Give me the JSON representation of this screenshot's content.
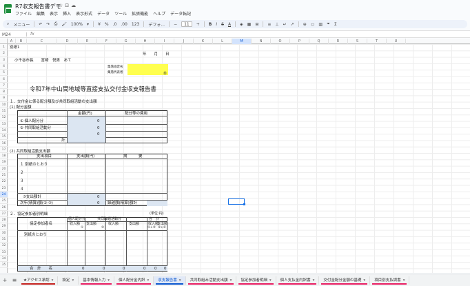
{
  "app": {
    "doc_title": "R7収支報告書デモ"
  },
  "menu": [
    "ファイル",
    "編集",
    "表示",
    "挿入",
    "表示形式",
    "データ",
    "ツール",
    "拡張機能",
    "ヘルプ",
    "データ転記"
  ],
  "toolbar": {
    "search": "メニュー",
    "zoom": "100%",
    "currency": "¥",
    "percent": "%",
    "dec_dec": ".0",
    "dec_inc": ".00",
    "format_123": "123",
    "font": "デフォ...",
    "font_size": "11",
    "bold": "B",
    "italic": "I",
    "strike": "S",
    "color_a": "A"
  },
  "formula": {
    "cell_ref": "M24",
    "fx": "fx"
  },
  "columns": [
    "A",
    "B",
    "C",
    "D",
    "E",
    "F",
    "G",
    "H",
    "I",
    "J",
    "K",
    "L",
    "M",
    "N",
    "O",
    "P",
    "Q",
    "R",
    "S",
    "T",
    "U"
  ],
  "rows": [
    "1",
    "2",
    "3",
    "4",
    "5",
    "6",
    "7",
    "8",
    "9",
    "10",
    "11",
    "12",
    "13",
    "14",
    "15",
    "16",
    "17",
    "18",
    "19",
    "20",
    "21",
    "22",
    "23",
    "24",
    "25",
    "26",
    "27",
    "28",
    "29",
    "30",
    "31",
    "32",
    "33",
    "34",
    "35"
  ],
  "sheet": {
    "form_no": "別紙1",
    "date": "年　　月　　日",
    "addressee": "小千谷市長　　宮崎　悦男　あて",
    "label_group": "集落協定名",
    "label_rep": "集落代表者",
    "seal": "㊞",
    "title": "令和7年中山間地域等直接支払交付金収支報告書",
    "sec1": "１．交付金に係る配分額及び共同取組活動の支出額",
    "sec1_1": "(1)  配分金額",
    "amt_hdr": "金額(円)",
    "content_hdr": "配分等の費用",
    "row_indiv": "① 個人配分分",
    "row_joint": "② 共同取組活動分",
    "row_total": "計",
    "zero": "0",
    "sec1_2": "(2)  共同取組活動支出額",
    "expense_item": "支出項目",
    "expense_amt": "支出額(円)",
    "remarks": "摘　　　要",
    "sep_paper": "別紙のとおり",
    "r1": "１",
    "r2": "２",
    "r3": "３",
    "r4": "４",
    "joint_total": "③支出額計",
    "carry": "次年(精算)額(②-③)",
    "carry_label": "繰越額(精算)額計",
    "sec2": "２．協定参加者別明細",
    "unit": "(単位:円)",
    "col_member": "協定参加者名",
    "col_indiv": "個人配分分",
    "col_joint": "共同取組活動分",
    "col_sum": "合　計",
    "col_recv": "収入額",
    "col_spend": "支出額",
    "col_recv_a": "①",
    "col_spend_b": "②",
    "col_sum_ab": "①+③",
    "col_sum_cd": "②+④",
    "sep_paper2": "別紙のとおり",
    "total_row": "合　計　　名"
  },
  "tabs": [
    {
      "label": "★アクセス承認",
      "color": "#c5221f"
    },
    {
      "label": "設定",
      "color": ""
    },
    {
      "label": "基本情報入力",
      "color": "#e91e63"
    },
    {
      "label": "個人配分金内訳",
      "color": "#e91e63"
    },
    {
      "label": "収支報告書",
      "color": "#0b57d0"
    },
    {
      "label": "共同取組み活動支出額",
      "color": "#e91e63"
    },
    {
      "label": "協定参加者明細",
      "color": "#e91e63"
    },
    {
      "label": "個人支払金内訳書",
      "color": "#e91e63"
    },
    {
      "label": "交付金配分金額の基礎",
      "color": "#e91e63"
    },
    {
      "label": "項目別支払調書",
      "color": "#e91e63"
    }
  ],
  "active_tab": 4,
  "colors": {
    "accent": "#0b57d0",
    "yellow": "#ffff4f",
    "blue_cell": "#dce6f2"
  }
}
